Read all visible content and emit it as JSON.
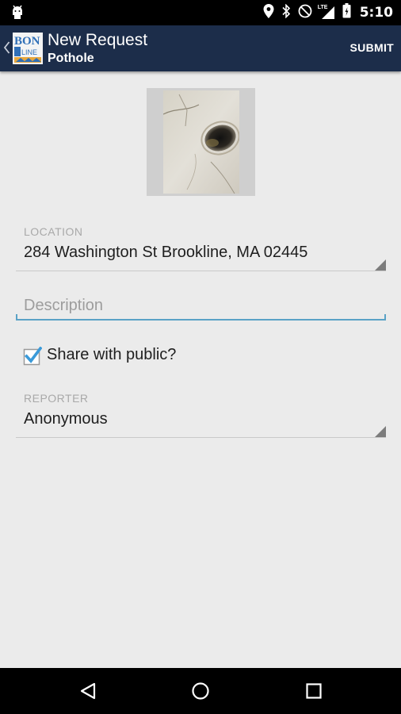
{
  "status_bar": {
    "time": "5:10",
    "network_label": "LTE",
    "icons": [
      "android-icon",
      "location-icon",
      "bluetooth-icon",
      "do-not-disturb-icon",
      "signal-icon",
      "battery-icon"
    ]
  },
  "action_bar": {
    "title": "New Request",
    "subtitle": "Pothole",
    "submit_label": "SUBMIT",
    "logo_text": [
      "BON",
      "LINE"
    ],
    "colors": {
      "background": "#1c2d4a",
      "logo_accent": "#2f6fb7",
      "logo_orange": "#e8a63a"
    }
  },
  "form": {
    "photo": {
      "subject": "pothole-photo"
    },
    "location": {
      "label": "LOCATION",
      "value": "284 Washington St Brookline, MA 02445"
    },
    "description": {
      "placeholder": "Description",
      "value": ""
    },
    "share": {
      "label": "Share with public?",
      "checked": true
    },
    "reporter": {
      "label": "REPORTER",
      "value": "Anonymous"
    }
  },
  "colors": {
    "accent": "#5aa2c6",
    "page_background": "#ebebeb",
    "label_gray": "#a9a9a9"
  },
  "nav_bar": {
    "buttons": [
      "back-icon",
      "home-icon",
      "recents-icon"
    ]
  }
}
